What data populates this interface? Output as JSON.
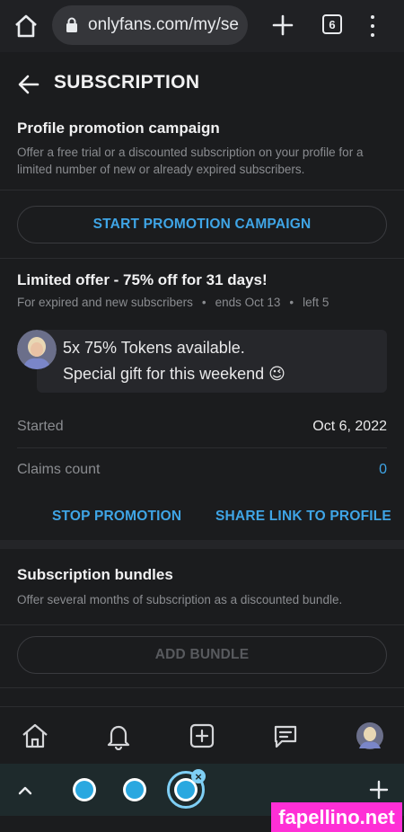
{
  "browser": {
    "url": "onlyfans.com/my/se",
    "tab_count": "6"
  },
  "header": {
    "title": "SUBSCRIPTION"
  },
  "promotion": {
    "title": "Profile promotion campaign",
    "description_line1": "Offer a free trial or a discounted subscription on your profile for a",
    "description_line2": "limited number of new or already expired subscribers.",
    "start_button": "START PROMOTION CAMPAIGN"
  },
  "offer": {
    "title": "Limited offer - 75% off for 31 days!",
    "audience": "For expired and new subscribers",
    "separator": "•",
    "ends": "ends Oct 13",
    "left": "left 5",
    "message_line1": "5x 75% Tokens available.",
    "message_line2": "Special gift for this weekend 😉",
    "started_label": "Started",
    "started_value": "Oct 6, 2022",
    "claims_label": "Claims count",
    "claims_value": "0",
    "stop_button": "STOP PROMOTION",
    "share_button": "SHARE LINK TO PROFILE"
  },
  "bundles": {
    "title": "Subscription bundles",
    "description": "Offer several months of subscription as a discounted bundle.",
    "add_button": "ADD BUNDLE"
  },
  "watermark": "fapellino.net",
  "colors": {
    "accent": "#3fa5e6",
    "background": "#1b1c1e",
    "watermark_bg": "#ff2fd6"
  }
}
